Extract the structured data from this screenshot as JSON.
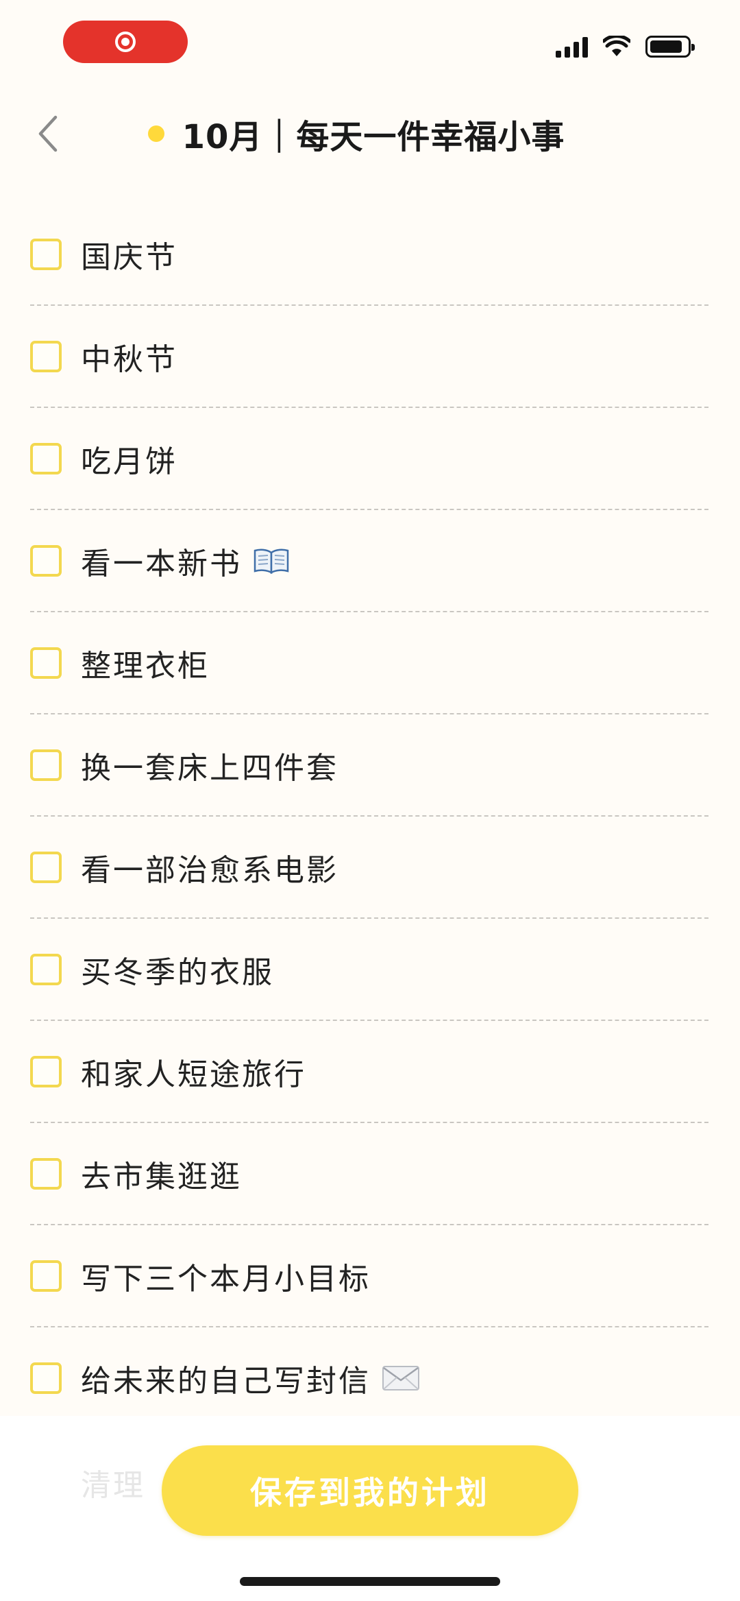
{
  "status_bar": {
    "record_icon": "screen-record-icon",
    "signal_icon": "cellular-signal-icon",
    "wifi_icon": "wifi-icon",
    "battery_icon": "battery-icon"
  },
  "nav": {
    "back_icon": "chevron-left-icon",
    "title": "10月｜每天一件幸福小事",
    "title_dot_color": "#ffd93b"
  },
  "checklist": {
    "checkbox_color": "#f3d84f",
    "items": [
      {
        "label": "国庆节"
      },
      {
        "label": "中秋节"
      },
      {
        "label": "吃月饼"
      },
      {
        "label": "看一本新书",
        "emoji": "open-book-emoji"
      },
      {
        "label": "整理衣柜"
      },
      {
        "label": "换一套床上四件套"
      },
      {
        "label": "看一部治愈系电影"
      },
      {
        "label": "买冬季的衣服"
      },
      {
        "label": "和家人短途旅行"
      },
      {
        "label": "去市集逛逛"
      },
      {
        "label": "写下三个本月小目标"
      },
      {
        "label": "给未来的自己写封信",
        "emoji": "envelope-emoji"
      }
    ],
    "partially_hidden_item": "清理"
  },
  "footer": {
    "save_label": "保存到我的计划",
    "button_color": "#fbdf4b"
  }
}
